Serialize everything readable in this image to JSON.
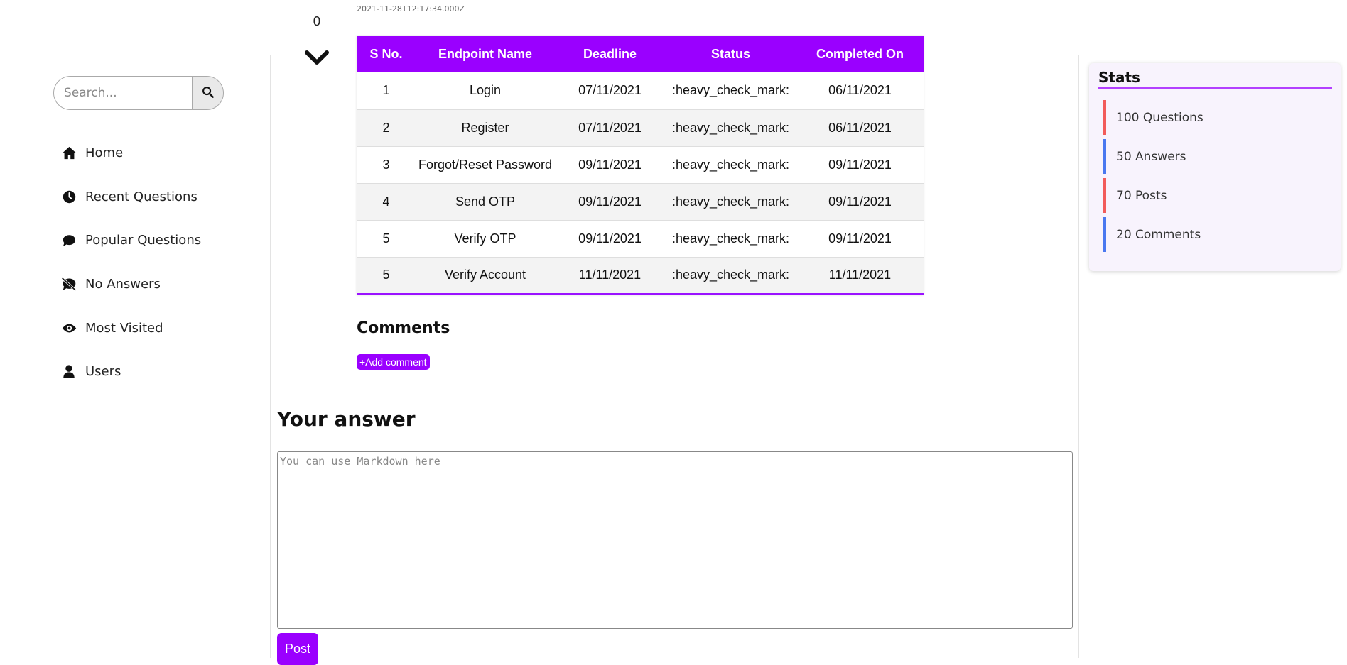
{
  "search": {
    "placeholder": "Search...",
    "value": ""
  },
  "nav": [
    {
      "label": "Home",
      "icon": "home-icon"
    },
    {
      "label": "Recent Questions",
      "icon": "clock-icon"
    },
    {
      "label": "Popular Questions",
      "icon": "comment-icon"
    },
    {
      "label": "No Answers",
      "icon": "comment-slash-icon"
    },
    {
      "label": "Most Visited",
      "icon": "eye-icon"
    },
    {
      "label": "Users",
      "icon": "user-icon"
    }
  ],
  "question": {
    "vote_count": "0",
    "timestamp": "2021-11-28T12:17:34.000Z"
  },
  "table": {
    "headers": [
      "S No.",
      "Endpoint Name",
      "Deadline",
      "Status",
      "Completed On"
    ],
    "rows": [
      [
        "1",
        "Login",
        "07/11/2021",
        ":heavy_check_mark:",
        "06/11/2021"
      ],
      [
        "2",
        "Register",
        "07/11/2021",
        ":heavy_check_mark:",
        "06/11/2021"
      ],
      [
        "3",
        "Forgot/Reset Password",
        "09/11/2021",
        ":heavy_check_mark:",
        "09/11/2021"
      ],
      [
        "4",
        "Send OTP",
        "09/11/2021",
        ":heavy_check_mark:",
        "09/11/2021"
      ],
      [
        "5",
        "Verify OTP",
        "09/11/2021",
        ":heavy_check_mark:",
        "09/11/2021"
      ],
      [
        "5",
        "Verify Account",
        "11/11/2021",
        ":heavy_check_mark:",
        "11/11/2021"
      ]
    ]
  },
  "comments": {
    "heading": "Comments",
    "add_label": "+Add comment"
  },
  "answer": {
    "heading": "Your answer",
    "placeholder": "You can use Markdown here",
    "post_label": "Post"
  },
  "stats": {
    "title": "Stats",
    "items": [
      {
        "label": "100 Questions",
        "color": "#f25b5b"
      },
      {
        "label": "50 Answers",
        "color": "#4a78f0"
      },
      {
        "label": "70 Posts",
        "color": "#f25b5b"
      },
      {
        "label": "20 Comments",
        "color": "#4a78f0"
      }
    ]
  },
  "colors": {
    "accent": "#9a00ff",
    "stats_red": "#f25b5b",
    "stats_blue": "#4a78f0"
  }
}
